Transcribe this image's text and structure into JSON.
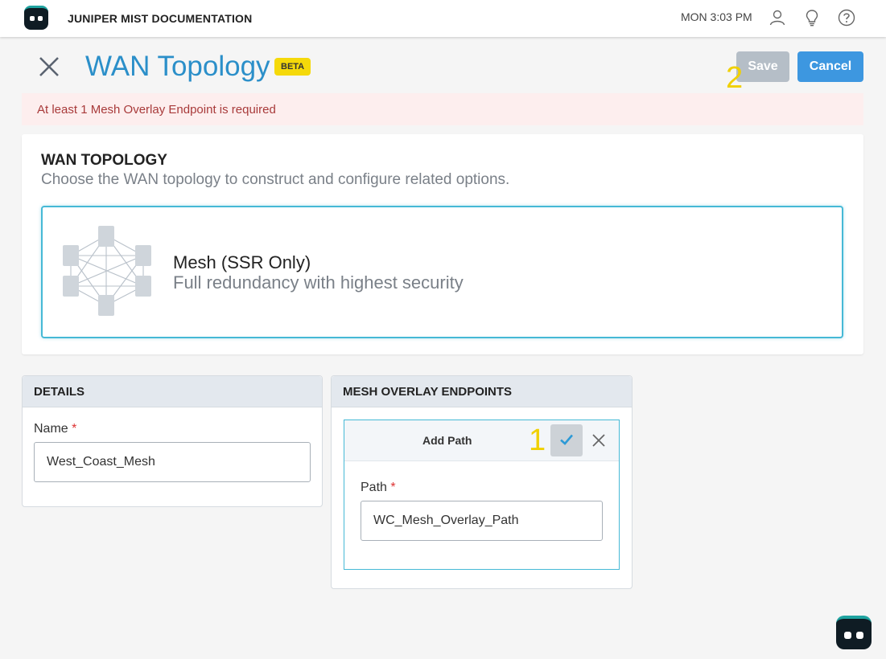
{
  "header": {
    "app_title": "JUNIPER MIST DOCUMENTATION",
    "clock": "MON 3:03 PM",
    "icons": [
      "user-icon",
      "lightbulb-icon",
      "help-icon"
    ]
  },
  "page": {
    "title": "WAN Topology",
    "badge": "BETA",
    "save_label": "Save",
    "cancel_label": "Cancel",
    "callout_save": "2",
    "callout_check": "1"
  },
  "error": {
    "message": "At least 1 Mesh Overlay Endpoint is required"
  },
  "topology": {
    "heading": "WAN TOPOLOGY",
    "subtitle": "Choose the WAN topology to construct and configure related options.",
    "option_title": "Mesh (SSR Only)",
    "option_description": "Full redundancy with highest security"
  },
  "details": {
    "heading": "DETAILS",
    "name_label": "Name",
    "required_marker": "*",
    "name_value": "West_Coast_Mesh"
  },
  "endpoints": {
    "heading": "MESH OVERLAY ENDPOINTS",
    "add_path_title": "Add Path",
    "path_label": "Path",
    "required_marker": "*",
    "path_value": "WC_Mesh_Overlay_Path"
  },
  "colors": {
    "accent_blue": "#3d97e0",
    "title_blue": "#2b8fc9",
    "beta_yellow": "#f5d90a",
    "error_text": "#a83a3a",
    "error_bg": "#fdeeee",
    "callout_yellow": "#f0d000",
    "selected_border": "#46b9d6"
  }
}
